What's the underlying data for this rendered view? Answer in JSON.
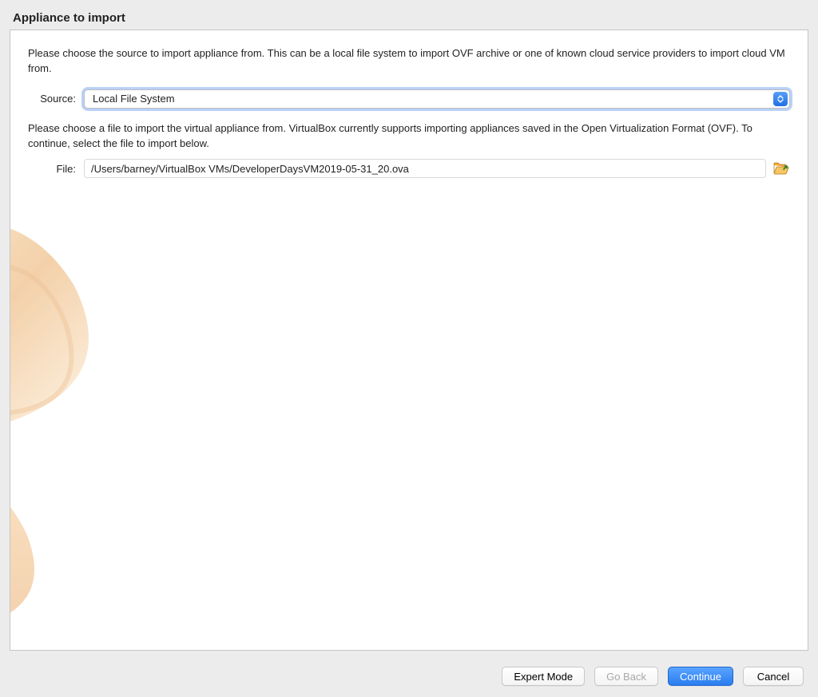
{
  "title": "Appliance to import",
  "intro": "Please choose the source to import appliance from. This can be a local file system to import OVF archive or one of known cloud service providers to import cloud VM from.",
  "source": {
    "label": "Source:",
    "value": "Local File System"
  },
  "desc2": "Please choose a file to import the virtual appliance from. VirtualBox currently supports importing appliances saved in the Open Virtualization Format (OVF). To continue, select the file to import below.",
  "file": {
    "label": "File:",
    "value": "/Users/barney/VirtualBox VMs/DeveloperDaysVM2019-05-31_20.ova"
  },
  "buttons": {
    "expert": "Expert Mode",
    "back": "Go Back",
    "continue": "Continue",
    "cancel": "Cancel"
  }
}
